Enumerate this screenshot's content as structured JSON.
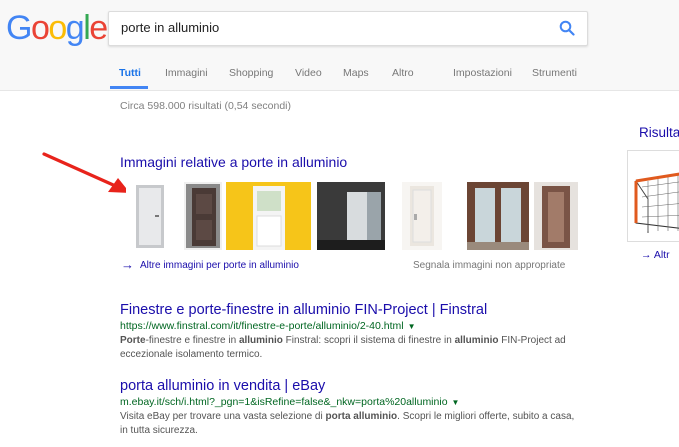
{
  "logo": {
    "letters": [
      "G",
      "o",
      "o",
      "g",
      "l",
      "e"
    ],
    "colors": [
      "#4285f4",
      "#ea4335",
      "#fbbc05",
      "#4285f4",
      "#34a853",
      "#ea4335"
    ]
  },
  "search": {
    "query": "porte in alluminio"
  },
  "tabs": [
    {
      "label": "Tutti",
      "active": true
    },
    {
      "label": "Immagini"
    },
    {
      "label": "Shopping"
    },
    {
      "label": "Video"
    },
    {
      "label": "Maps"
    },
    {
      "label": "Altro"
    },
    {
      "label": "Impostazioni"
    },
    {
      "label": "Strumenti"
    }
  ],
  "stats": "Circa 598.000 risultati (0,54 secondi)",
  "images_block": {
    "heading": "Immagini relative a porte in alluminio",
    "more_label": "Altre immagini per porte in alluminio",
    "report_label": "Segnala immagini non appropriate"
  },
  "side_panel": {
    "title": "Risulta",
    "more": "Altr"
  },
  "results": [
    {
      "title": "Finestre e porte-finestre in alluminio FIN-Project | Finstral",
      "url": "https://www.finstral.com/it/finestre-e-porte/alluminio/2-40.html",
      "snippet_1_bold": "Porte",
      "snippet_1_rest": "-finestre e finestre in ",
      "snippet_1_bold2": "alluminio",
      "snippet_1_rest2": " Finstral: scopri il sistema di finestre in ",
      "snippet_1_bold3": "alluminio",
      "snippet_1_rest3": " FIN-Project ad",
      "snippet_2": "eccezionale isolamento termico."
    },
    {
      "title": "porta alluminio in vendita | eBay",
      "url": "m.ebay.it/sch/i.html?_pgn=1&isRefine=false&_nkw=porta%20alluminio",
      "snippet_1_rest": "Visita eBay per trovare una vasta selezione di ",
      "snippet_1_bold": "porta alluminio",
      "snippet_1_rest2": ". Scopri le migliori offerte, subito a casa,",
      "snippet_2": "in tutta sicurezza."
    }
  ]
}
